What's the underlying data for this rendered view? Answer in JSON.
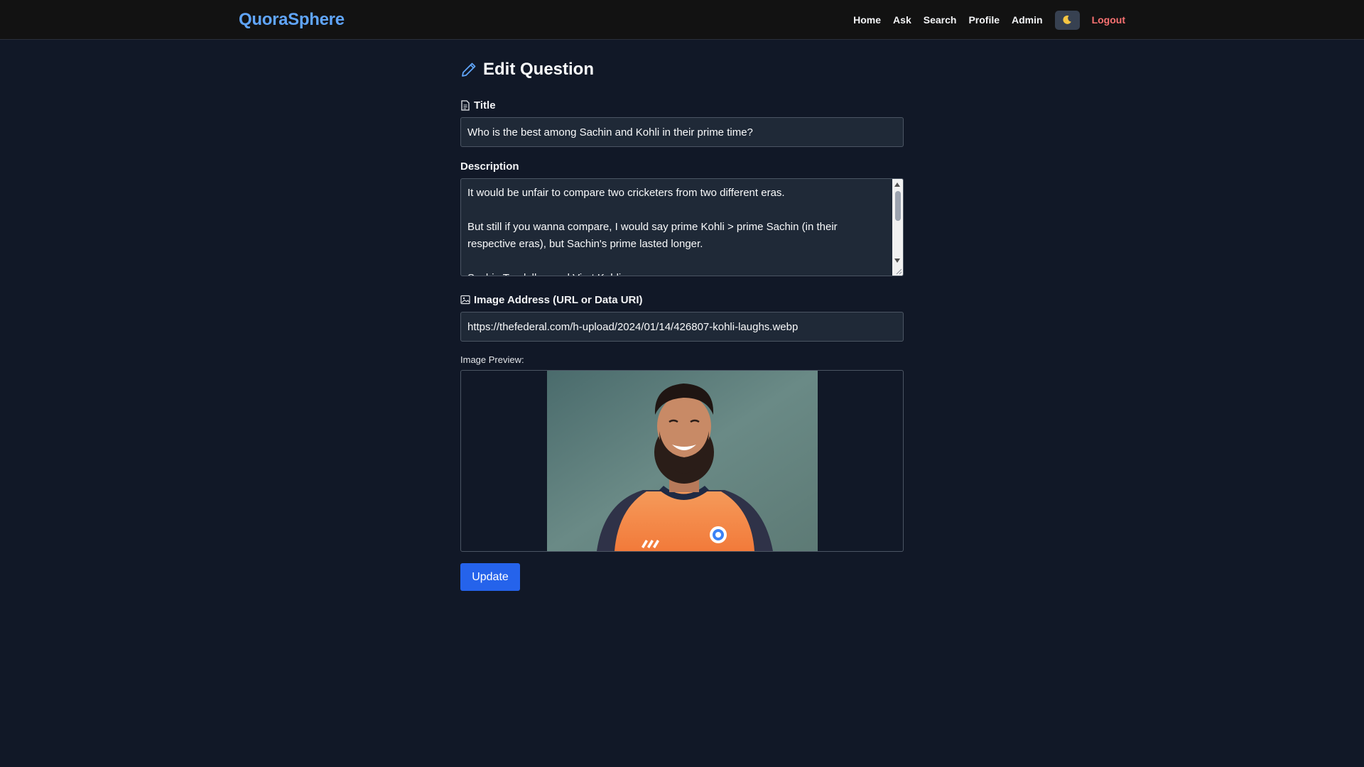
{
  "navbar": {
    "brand": "QuoraSphere",
    "links": [
      "Home",
      "Ask",
      "Search",
      "Profile",
      "Admin"
    ],
    "theme_icon": "moon-icon",
    "logout": "Logout"
  },
  "page": {
    "title": "Edit Question",
    "title_icon": "pencil-icon"
  },
  "form": {
    "title_label": "Title",
    "title_value": "Who is the best among Sachin and Kohli in their prime time?",
    "description_label": "Description",
    "description_paragraphs": [
      "It would be unfair to compare two cricketers from two different eras.",
      "But still if you wanna compare, I would say prime Kohli > prime Sachin (in their respective eras), but Sachin's prime lasted longer.",
      "Sachin Tendulkar and Virat Kohli"
    ],
    "image_label": "Image Address (URL or Data URI)",
    "image_value": "https://thefederal.com/h-upload/2024/01/14/426807-kohli-laughs.webp",
    "preview_label": "Image Preview:",
    "update_button": "Update"
  },
  "colors": {
    "background": "#111827",
    "navbar": "#121212",
    "brand": "#60a5fa",
    "accent_button": "#2563eb",
    "logout": "#f87171"
  }
}
